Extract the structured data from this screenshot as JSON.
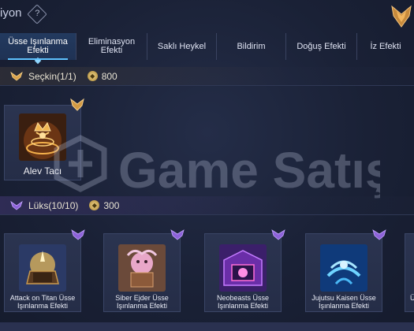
{
  "header": {
    "title": "iyon",
    "help_icon": "question-icon",
    "emblem_icon": "rank-emblem-icon"
  },
  "tabs": [
    {
      "line1": "Üsse Işınlanma",
      "line2": "Efekti",
      "active": true
    },
    {
      "line1": "Eliminasyon",
      "line2": "Efekti",
      "active": false
    },
    {
      "line1": "Saklı Heykel",
      "line2": "",
      "active": false
    },
    {
      "line1": "Bildirim",
      "line2": "",
      "active": false
    },
    {
      "line1": "Doğuş Efekti",
      "line2": "",
      "active": false
    },
    {
      "line1": "İz Efekti",
      "line2": "",
      "active": false
    }
  ],
  "sections": {
    "secret": {
      "label": "Seçkin(1/1)",
      "cost": "800",
      "accent": "#d4a04a"
    },
    "lux": {
      "label": "Lüks(10/10)",
      "cost": "300",
      "accent": "#8a63d8"
    }
  },
  "featured": {
    "name": "Alev Tacı"
  },
  "cards": [
    {
      "line1": "Attack on Titan Üsse",
      "line2": "Işınlanma Efekti"
    },
    {
      "line1": "Siber Ejder Üsse",
      "line2": "Işınlanma Efekti"
    },
    {
      "line1": "Neobeasts Üsse",
      "line2": "Işınlanma Efekti"
    },
    {
      "line1": "Jujutsu Kaisen Üsse",
      "line2": "Işınlanma Efekti"
    },
    {
      "line1": "Ü",
      "line2": ""
    }
  ],
  "watermark": {
    "text": "Game Satış"
  },
  "colors": {
    "background": "#1b2238",
    "active_tab": "#233a5f",
    "tab_underline": "#5ec2ff"
  }
}
